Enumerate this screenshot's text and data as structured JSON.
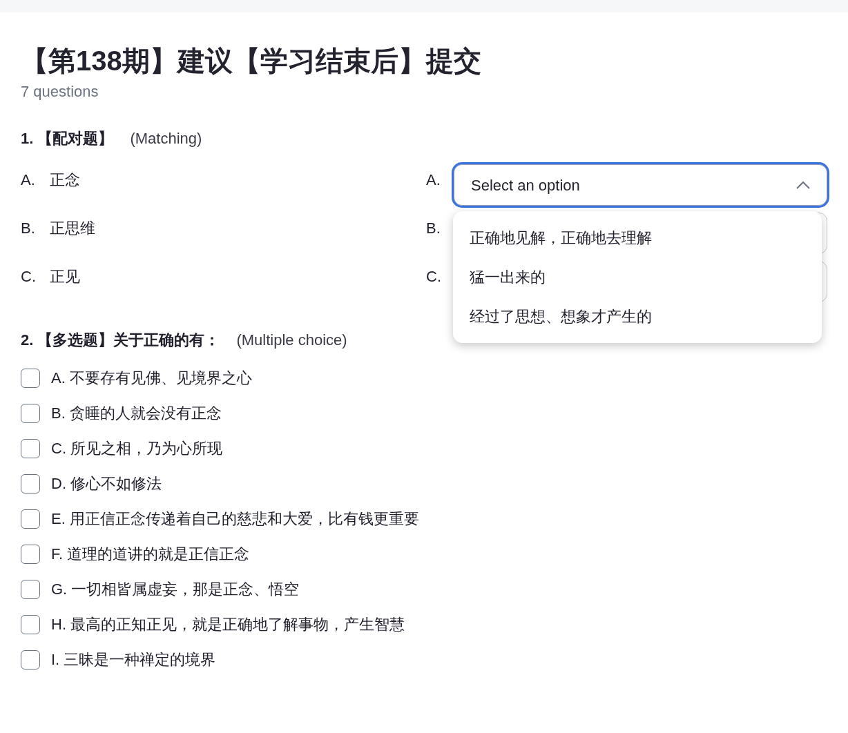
{
  "quiz": {
    "title": "【第138期】建议【学习结束后】提交",
    "subtitle": "7 questions"
  },
  "questions": [
    {
      "kind": "matching",
      "number": "1.",
      "label": "【配对题】",
      "type": "(Matching)",
      "prompts": [
        {
          "letter": "A.",
          "text": "正念"
        },
        {
          "letter": "B.",
          "text": "正思维"
        },
        {
          "letter": "C.",
          "text": "正见"
        }
      ],
      "answers": [
        {
          "letter": "A.",
          "expanded": true,
          "placeholder": "Select an option",
          "options": [
            "正确地见解，正确地去理解",
            "猛一出来的",
            "经过了思想、想象才产生的"
          ]
        },
        {
          "letter": "B.",
          "expanded": false
        },
        {
          "letter": "C.",
          "expanded": false
        }
      ]
    },
    {
      "kind": "multiple",
      "number": "2.",
      "label": "【多选题】关于正确的有：",
      "type": "(Multiple choice)",
      "choices": [
        {
          "text": "A. 不要存有见佛、见境界之心",
          "checked": false
        },
        {
          "text": "B. 贪睡的人就会没有正念",
          "checked": false
        },
        {
          "text": "C. 所见之相，乃为心所现",
          "checked": false
        },
        {
          "text": "D. 修心不如修法",
          "checked": false
        },
        {
          "text": "E. 用正信正念传递着自己的慈悲和大爱，比有钱更重要",
          "checked": false
        },
        {
          "text": "F. 道理的道讲的就是正信正念",
          "checked": false
        },
        {
          "text": "G. 一切相皆属虚妄，那是正念、悟空",
          "checked": false
        },
        {
          "text": "H. 最高的正知正见，就是正确地了解事物，产生智慧",
          "checked": false
        },
        {
          "text": "I. 三昧是一种禅定的境界",
          "checked": false
        }
      ]
    }
  ]
}
